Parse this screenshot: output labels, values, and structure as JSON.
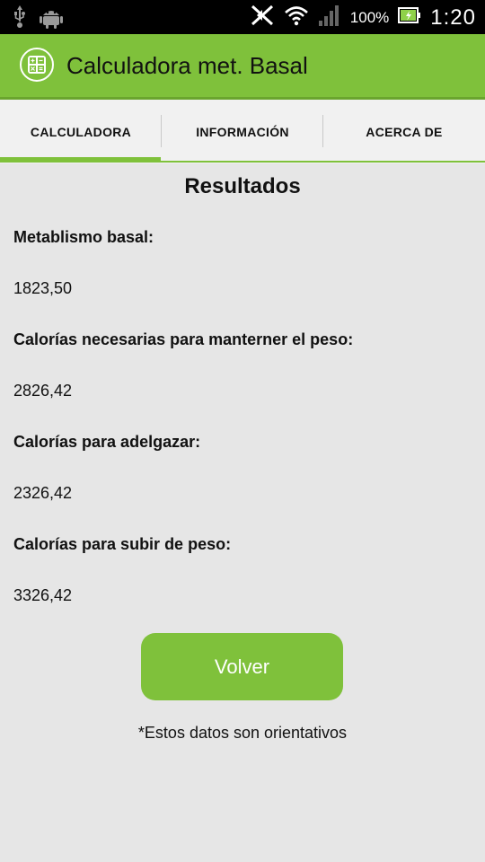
{
  "status_bar": {
    "battery_percent": "100%",
    "time": "1:20",
    "icons": [
      "usb-icon",
      "android-debug-icon",
      "mute-icon",
      "wifi-icon",
      "signal-icon",
      "battery-charging-icon"
    ]
  },
  "action_bar": {
    "title": "Calculadora met. Basal",
    "icon": "calculator-icon",
    "color": "#7fc13b"
  },
  "tabs": [
    {
      "label": "CALCULADORA",
      "selected": true
    },
    {
      "label": "INFORMACIÓN",
      "selected": false
    },
    {
      "label": "ACERCA DE",
      "selected": false
    }
  ],
  "results": {
    "title": "Resultados",
    "items": [
      {
        "label": "Metablismo basal:",
        "value": "1823,50"
      },
      {
        "label": "Calorías necesarias para manterner el peso:",
        "value": "2826,42"
      },
      {
        "label": "Calorías para adelgazar:",
        "value": "2326,42"
      },
      {
        "label": "Calorías para subir de peso:",
        "value": "3326,42"
      }
    ]
  },
  "back_button": {
    "label": "Volver"
  },
  "note": "*Estos datos son orientativos"
}
